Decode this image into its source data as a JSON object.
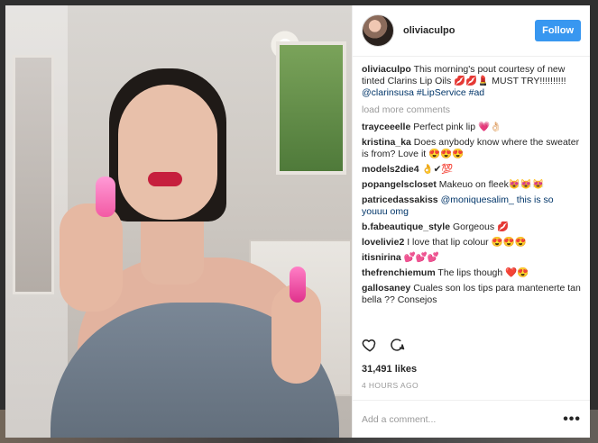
{
  "post": {
    "username": "oliviaculpo",
    "follow_label": "Follow",
    "caption_user": "oliviaculpo",
    "caption_text": "This morning's pout courtesy of new tinted Clarins Lip Oils 💋💋💄 MUST TRY!!!!!!!!!!",
    "caption_mentions": "@clarinsusa #LipService #ad",
    "load_more": "load more comments",
    "comments": [
      {
        "user": "trayceeelle",
        "text": "Perfect pink lip 💗👌🏻"
      },
      {
        "user": "kristina_ka",
        "text": "Does anybody know where the sweater is from? Love it 😍😍😍"
      },
      {
        "user": "models2die4",
        "text": "👌✔💯"
      },
      {
        "user": "popangelscloset",
        "text": "Makeuo on fleek😻😻😻"
      },
      {
        "user": "patricedassakiss",
        "text": "@moniquesalim_ this is so youuu omg"
      },
      {
        "user": "b.fabeautique_style",
        "text": "Gorgeous 💋"
      },
      {
        "user": "lovelivie2",
        "text": "I love that lip colour 😍😍😍"
      },
      {
        "user": "itisnirina",
        "text": "💕💕💕"
      },
      {
        "user": "thefrenchiemum",
        "text": "The lips though ❤️😍"
      },
      {
        "user": "gallosaney",
        "text": "Cuales son los tips para mantenerte tan bella ?? Consejos"
      }
    ],
    "likes": "31,491 likes",
    "time": "4 HOURS AGO",
    "add_comment_placeholder": "Add a comment...",
    "more_dots": "•••"
  },
  "icons": {
    "like": "heart-icon",
    "comment": "comment-icon"
  },
  "colors": {
    "follow_bg": "#3897f0",
    "mention": "#003569",
    "muted": "#999999"
  }
}
